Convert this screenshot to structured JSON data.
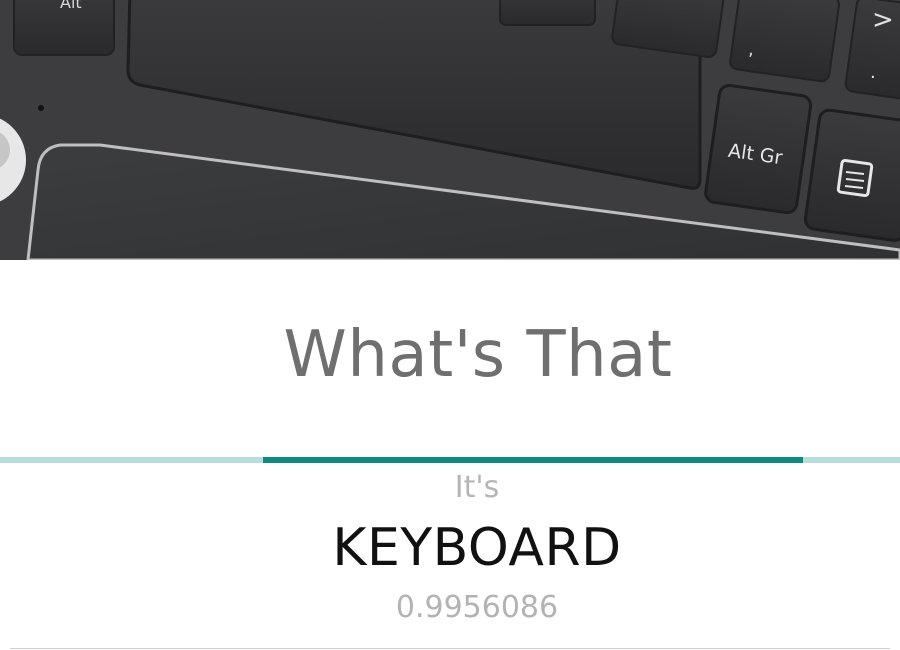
{
  "app": {
    "title": "What's That"
  },
  "image_preview": {
    "icon": "keyboard-photo"
  },
  "progress": {
    "value": 0.6,
    "track_color": "#b7dedc",
    "fill_color": "#0f8a7e"
  },
  "result": {
    "prefix": "It's",
    "label": "KEYBOARD",
    "confidence": "0.9956086"
  }
}
